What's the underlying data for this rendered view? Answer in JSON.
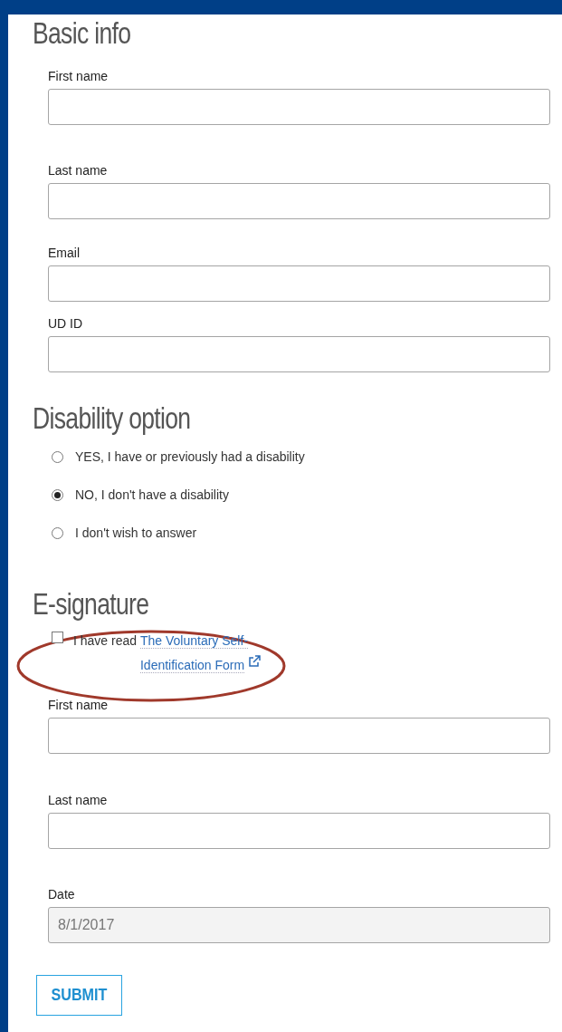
{
  "basic_info": {
    "title": "Basic info",
    "fields": [
      {
        "label": "First name"
      },
      {
        "label": "Last name"
      },
      {
        "label": "Email"
      },
      {
        "label": "UD ID"
      }
    ]
  },
  "disability_option": {
    "title": "Disability option",
    "options": [
      {
        "label": "YES, I have or previously had a disability",
        "selected": false
      },
      {
        "label": "NO, I don't have a disability",
        "selected": true
      },
      {
        "label": "I don't wish to answer",
        "selected": false
      }
    ]
  },
  "e_signature": {
    "title": "E-signature",
    "acknowledgement": {
      "text": "I have read",
      "link": "The Voluntary Self-Identification Form",
      "checked": false
    },
    "fields": [
      {
        "label": "First name",
        "disabled": false
      },
      {
        "label": "Last name",
        "disabled": false
      },
      {
        "label": "Date",
        "value": "8/1/2017",
        "disabled": true
      }
    ]
  },
  "submit_button": "SUBMIT"
}
